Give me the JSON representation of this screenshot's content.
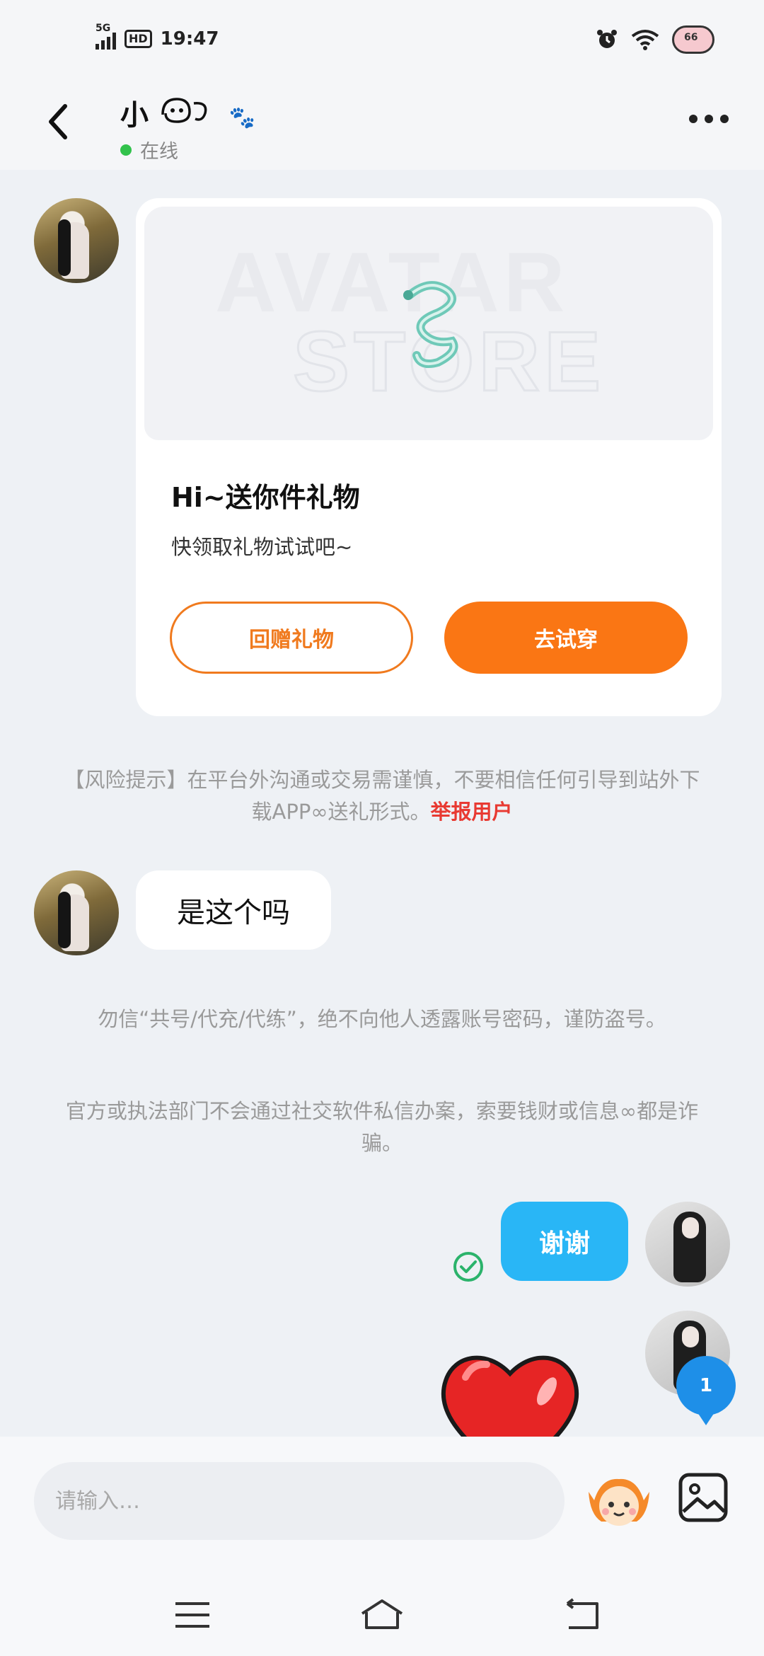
{
  "status_bar": {
    "network": "5G",
    "hd": "HD",
    "time": "19:47",
    "battery": "66"
  },
  "header": {
    "title": "小",
    "status": "在线"
  },
  "gift_card": {
    "title": "Hi~送你件礼物",
    "subtitle": "快领取礼物试试吧~",
    "return_label": "回赠礼物",
    "try_label": "去试穿"
  },
  "risk_notice": {
    "text": "【风险提示】在平台外沟通或交易需谨慎，不要相信任何引导到站外下载APP∞送礼形式。",
    "link": "举报用户"
  },
  "messages": {
    "incoming_text": "是这个吗",
    "outgoing_text": "谢谢"
  },
  "warnings": {
    "line1": "勿信“共号/代充/代练”，绝不向他人透露账号密码，谨防盗号。",
    "line2": "官方或执法部门不会通过社交软件私信办案，索要钱财或信息∞都是诈骗。"
  },
  "unread_count": "1",
  "input": {
    "placeholder": "请输入…"
  },
  "colors": {
    "accent_orange": "#fa7614",
    "bubble_blue": "#29b6f6",
    "report_red": "#e83a32",
    "online_green": "#32c24c"
  }
}
